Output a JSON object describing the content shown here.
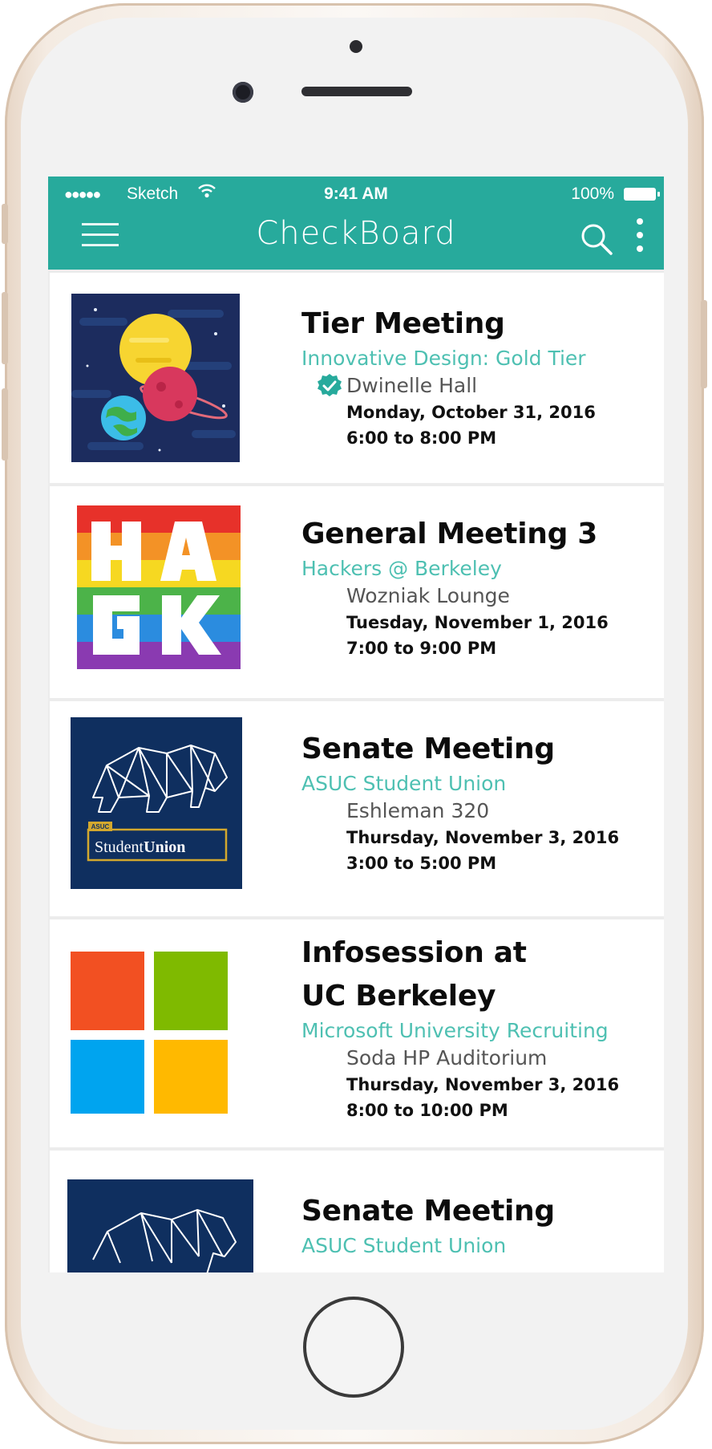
{
  "status_bar": {
    "signal": "●●●●●",
    "carrier": "Sketch",
    "time": "9:41 AM",
    "battery": "100%"
  },
  "app_bar": {
    "title": "CheckBoard"
  },
  "colors": {
    "accent": "#27aa9c",
    "org_text": "#4ec0b2",
    "navy": "#0f2f5f"
  },
  "events": [
    {
      "title": "Tier Meeting",
      "organization": "Innovative Design: Gold Tier",
      "location": "Dwinelle Hall",
      "date": "Monday, October 31, 2016",
      "time": "6:00 to 8:00 PM",
      "verified": true,
      "image": "planets-illustration"
    },
    {
      "title": "General Meeting 3",
      "organization": "Hackers @ Berkeley",
      "location": "Wozniak Lounge",
      "date": "Tuesday, November 1, 2016",
      "time": "7:00 to 9:00 PM",
      "verified": false,
      "image": "hack-rainbow-logo"
    },
    {
      "title": "Senate Meeting",
      "organization": "ASUC Student Union",
      "location": "Eshleman 320",
      "date": "Thursday, November 3, 2016",
      "time": "3:00 to 5:00 PM",
      "verified": false,
      "image": "student-union-bear-logo",
      "logo_small": "ASUC",
      "logo_text_a": "Student",
      "logo_text_b": "Union"
    },
    {
      "title_line1": "Infosession at",
      "title_line2": "UC Berkeley",
      "organization": "Microsoft University Recruiting",
      "location": "Soda HP Auditorium",
      "date": "Thursday, November 3, 2016",
      "time": "8:00 to 10:00 PM",
      "verified": false,
      "image": "microsoft-logo"
    },
    {
      "title": "Senate Meeting",
      "organization": "ASUC Student Union",
      "image": "student-union-bear-logo"
    }
  ]
}
